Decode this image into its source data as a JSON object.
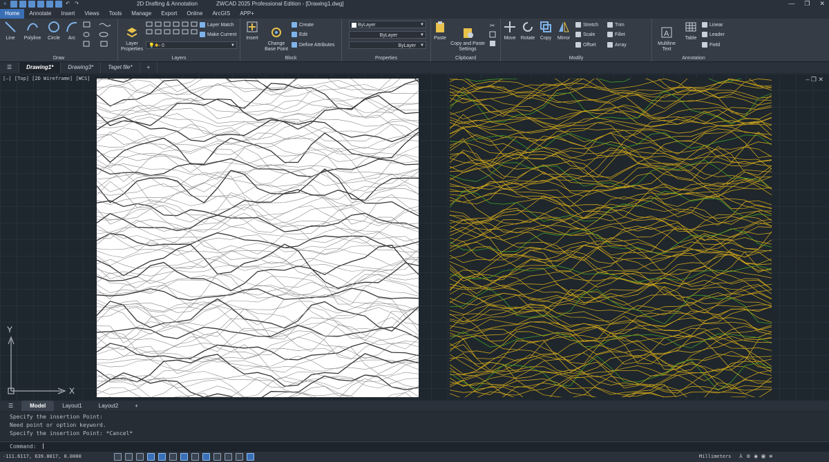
{
  "titlebar": {
    "workspace": "2D Drafting & Annotation",
    "app_title": "ZWCAD 2025 Professional Edition - [Drawing1.dwg]",
    "min": "—",
    "max": "❐",
    "close": "✕"
  },
  "ribbon_tabs": [
    "Home",
    "Annotate",
    "Insert",
    "Views",
    "Tools",
    "Manage",
    "Export",
    "Online",
    "ArcGIS",
    "APP+"
  ],
  "ribbon": {
    "draw": {
      "label": "Draw",
      "line": "Line",
      "polyline": "Polyline",
      "circle": "Circle",
      "arc": "Arc"
    },
    "layers": {
      "label": "Layers",
      "layer_properties": "Layer\nProperties",
      "layer_match": "Layer Match",
      "make_current": "Make Current",
      "layer_value": "0"
    },
    "block": {
      "label": "Block",
      "insert": "Insert",
      "change_base_point": "Change\nBase Point",
      "create": "Create",
      "edit": "Edit",
      "define_attributes": "Define Attributes"
    },
    "properties": {
      "label": "Properties",
      "color": "ByLayer",
      "linetype": "ByLayer",
      "lineweight": "ByLayer"
    },
    "clipboard": {
      "label": "Clipboard",
      "paste": "Paste",
      "copy_paste_settings": "Copy and Paste\nSettings"
    },
    "modify": {
      "label": "Modify",
      "move": "Move",
      "rotate": "Rotate",
      "copy": "Copy",
      "mirror": "Mirror",
      "stretch": "Stretch",
      "scale": "Scale",
      "offset": "Offset",
      "trim": "Trim",
      "fillet": "Fillet",
      "array": "Array"
    },
    "annotation": {
      "label": "Annotation",
      "multiline_text": "Multiline\nText",
      "table": "Table",
      "linear": "Linear",
      "leader": "Leader",
      "field": "Field"
    }
  },
  "doc_tabs": [
    "Drawing1*",
    "Drawing3*",
    "Taget file*"
  ],
  "viewport_label": "[—] [Top] [2D Wireframe] [WCS]",
  "ucs": {
    "x": "X",
    "y": "Y"
  },
  "layout_tabs": [
    "Model",
    "Layout1",
    "Layout2"
  ],
  "command_history": [
    "Specify the insertion Point:",
    "Need point or option keyword.",
    "Specify the insertion Point: *Cancel*"
  ],
  "command_prompt": "Command:",
  "status": {
    "coords": "-111.6117, 639.8017, 0.0000",
    "units": "Millimeters"
  },
  "colors": {
    "accent": "#3a6fb5",
    "background": "#1e262e",
    "contour_left_bg": "#ffffff",
    "contour_right": "#c9a21c",
    "contour_right_green": "#3fa02a"
  }
}
